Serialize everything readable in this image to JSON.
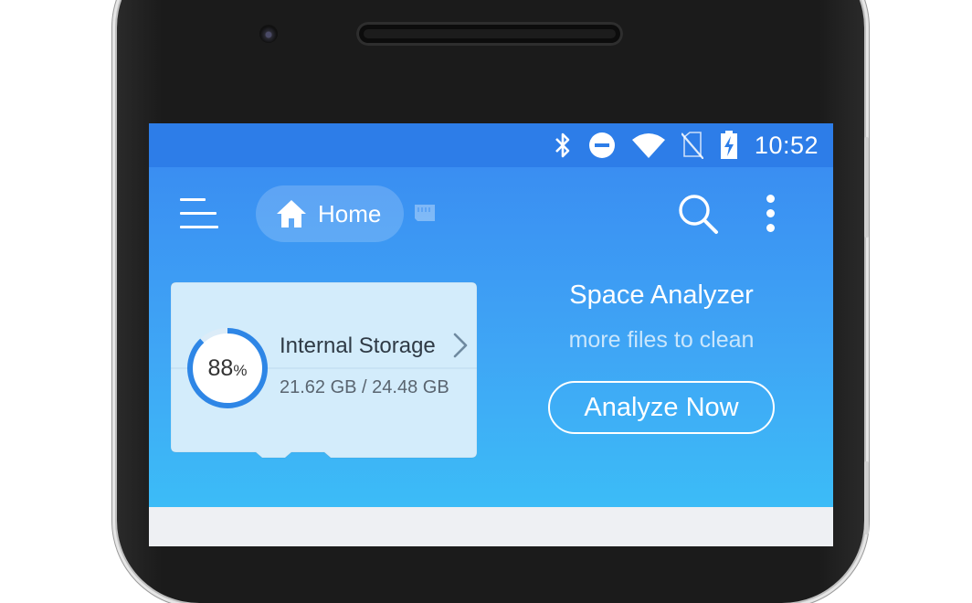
{
  "status_bar": {
    "time": "10:52",
    "icons": [
      "bluetooth-icon",
      "do-not-disturb-icon",
      "wifi-icon",
      "no-sim-icon",
      "battery-charging-icon"
    ]
  },
  "toolbar": {
    "menu_icon": "hamburger-menu-icon",
    "home_label": "Home",
    "home_icon": "home-icon",
    "storage_icon": "sd-card-icon",
    "search_icon": "search-icon",
    "more_icon": "more-vertical-icon"
  },
  "storage_card": {
    "usage_percent": "88",
    "usage_value": 0.88,
    "percent_sign": "%",
    "title": "Internal Storage",
    "size": "21.62 GB / 24.48 GB"
  },
  "analyzer": {
    "title": "Space Analyzer",
    "subtitle": "more files to clean",
    "button": "Analyze Now"
  },
  "colors": {
    "status_bar": "#2d7de8",
    "hero_top": "#3a8ef2",
    "hero_bottom": "#3cbcf7",
    "card": "#d3ecfb",
    "ring": "#2e86e6"
  }
}
